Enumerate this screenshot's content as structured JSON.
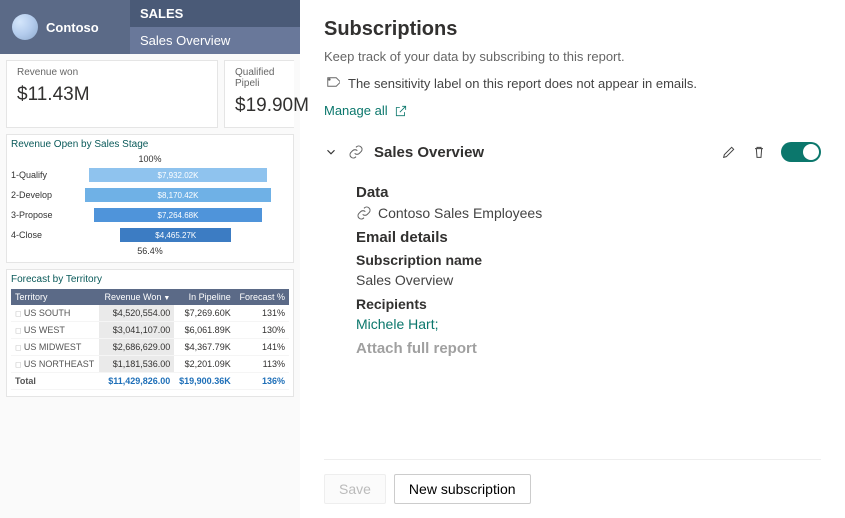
{
  "brand": "Contoso",
  "nav": {
    "section": "SALES",
    "page": "Sales Overview"
  },
  "kpis": {
    "rev_won_label": "Revenue won",
    "rev_won": "$11.43M",
    "qual_label": "Qualified Pipeli",
    "qual": "$19.90M"
  },
  "stageChart": {
    "title": "Revenue Open by Sales Stage",
    "topPct": "100%",
    "botPct": "56.4%",
    "rows": [
      {
        "label": "1-Qualify",
        "value": "$7,932.02K"
      },
      {
        "label": "2-Develop",
        "value": "$8,170.42K"
      },
      {
        "label": "3-Propose",
        "value": "$7,264.68K"
      },
      {
        "label": "4-Close",
        "value": "$4,465.27K"
      }
    ]
  },
  "forecast": {
    "title": "Forecast by Territory",
    "headers": [
      "Territory",
      "Revenue Won",
      "In Pipeline",
      "Forecast %"
    ],
    "rows": [
      [
        "US SOUTH",
        "$4,520,554.00",
        "$7,269.60K",
        "131%"
      ],
      [
        "US WEST",
        "$3,041,107.00",
        "$6,061.89K",
        "130%"
      ],
      [
        "US MIDWEST",
        "$2,686,629.00",
        "$4,367.79K",
        "141%"
      ],
      [
        "US NORTHEAST",
        "$1,181,536.00",
        "$2,201.09K",
        "113%"
      ]
    ],
    "total": [
      "Total",
      "$11,429,826.00",
      "$19,900.36K",
      "136%"
    ]
  },
  "panel": {
    "title": "Subscriptions",
    "desc": "Keep track of your data by subscribing to this report.",
    "notice": "The sensitivity label on this report does not appear in emails.",
    "manage": "Manage all",
    "subName": "Sales Overview",
    "dataHdr": "Data",
    "dataVal": "Contoso Sales Employees",
    "emailHdr": "Email details",
    "subNameHdr": "Subscription name",
    "subNameVal": "Sales Overview",
    "recipHdr": "Recipients",
    "recipVal": "Michele Hart;",
    "cutoff": "Attach full report",
    "saveBtn": "Save",
    "newBtn": "New subscription"
  },
  "chart_data": {
    "type": "bar",
    "title": "Revenue Open by Sales Stage",
    "categories": [
      "1-Qualify",
      "2-Develop",
      "3-Propose",
      "4-Close"
    ],
    "values": [
      7932.02,
      8170.42,
      7264.68,
      4465.27
    ],
    "units": "K USD",
    "funnel_top_pct": 100,
    "funnel_bottom_pct": 56.4
  }
}
